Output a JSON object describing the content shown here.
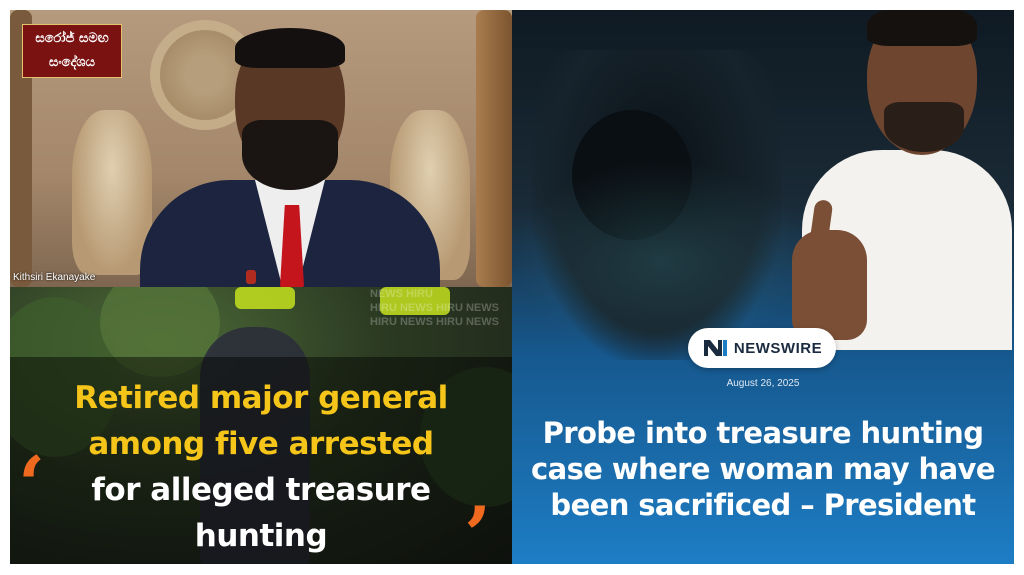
{
  "left_top": {
    "logo_line1": "සරෝජ් සමඟ",
    "logo_line2": "සංදේශය",
    "caller_name": "Kithsiri Ekanayake"
  },
  "left_bottom": {
    "watermark_lines": [
      "NEWS HIRU",
      "HIRU NEWS HIRU NEWS",
      "HIRU NEWS HIRU NEWS"
    ],
    "headline_yellow": [
      "Retired major general",
      "among five arrested"
    ],
    "headline_white": [
      "for alleged treasure",
      "hunting"
    ],
    "quote_open": "‘",
    "quote_close": "’",
    "colors": {
      "yellow": "#f6c51a",
      "quote": "#ef6a1f"
    }
  },
  "right": {
    "brand": "NEWSWIRE",
    "brand_icon": "newswire-n-logo",
    "date": "August 26, 2025",
    "headline": [
      "Probe into treasure hunting",
      "case where woman may have",
      "been sacrificed – President"
    ],
    "colors": {
      "background_bottom": "#1d7dc4",
      "pill": "#ffffff"
    }
  }
}
